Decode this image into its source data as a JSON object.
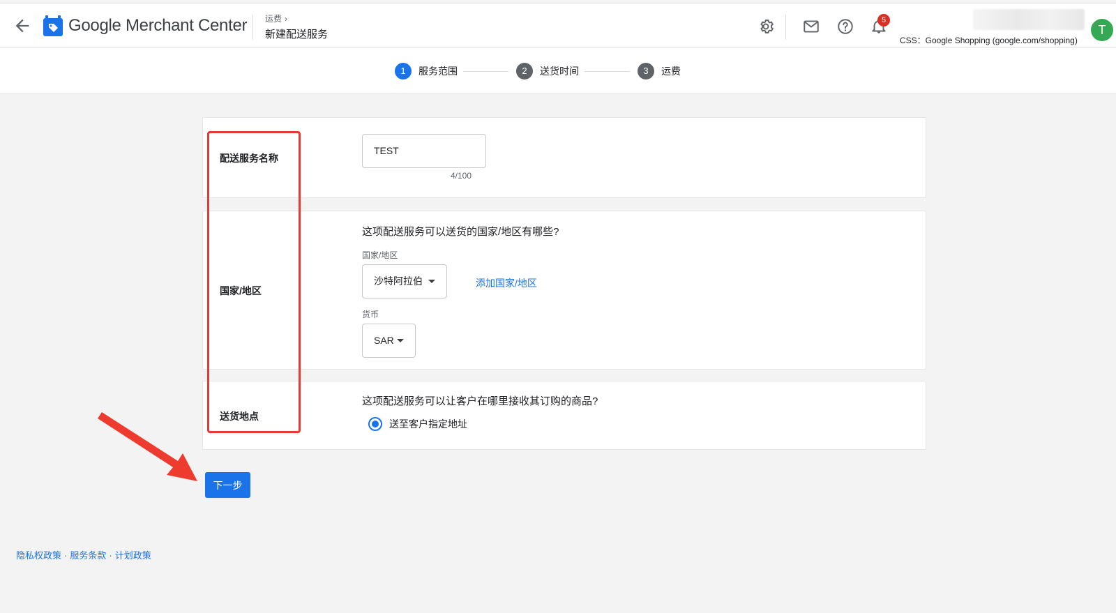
{
  "header": {
    "product_name": "Google Merchant Center",
    "breadcrumb": "运费",
    "page_title": "新建配送服务",
    "notification_count": "5",
    "account_line": "CSS：Google Shopping (google.com/shopping)",
    "avatar_initial": "T",
    "icons": [
      "back-arrow-icon",
      "merchant-center-logo",
      "gear-icon",
      "mail-icon",
      "help-icon",
      "bell-icon"
    ]
  },
  "stepper": {
    "steps": [
      {
        "number": "1",
        "label": "服务范围",
        "active": true
      },
      {
        "number": "2",
        "label": "送货时间",
        "active": false
      },
      {
        "number": "3",
        "label": "运费",
        "active": false
      }
    ]
  },
  "form": {
    "service_name": {
      "label": "配送服务名称",
      "value": "TEST",
      "counter": "4/100"
    },
    "country": {
      "label": "国家/地区",
      "question": "这项配送服务可以送货的国家/地区有哪些?",
      "country_label": "国家/地区",
      "country_value": "沙特阿拉伯",
      "add_link": "添加国家/地区",
      "currency_label": "货币",
      "currency_value": "SAR"
    },
    "delivery_location": {
      "label": "送货地点",
      "question": "这项配送服务可以让客户在哪里接收其订购的商品?",
      "option_label": "送至客户指定地址"
    }
  },
  "actions": {
    "next_label": "下一步"
  },
  "footer": {
    "links": [
      "隐私权政策",
      "服务条款",
      "计划政策"
    ],
    "separator": "·"
  },
  "colors": {
    "primary": "#1a73e8",
    "annotation_red": "#e53935",
    "badge_red": "#d93025",
    "avatar_green": "#34a853"
  }
}
